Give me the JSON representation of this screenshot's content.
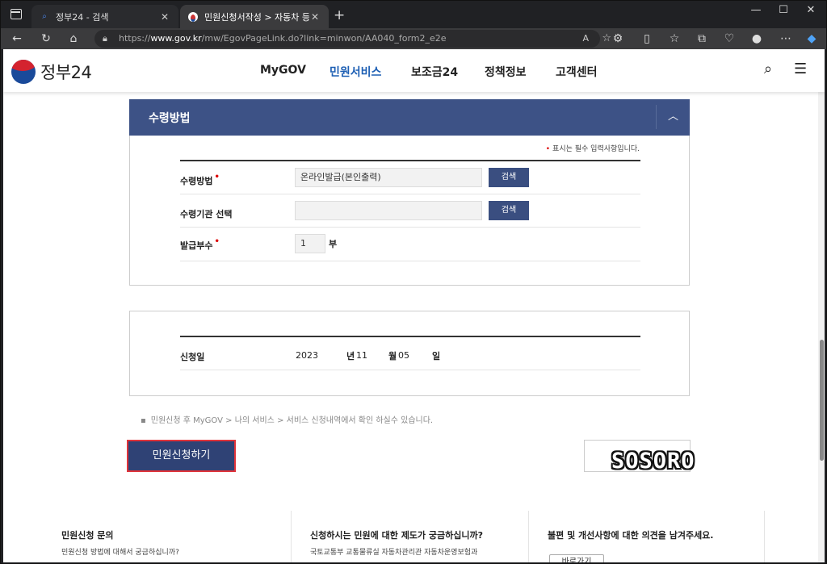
{
  "browser": {
    "tabs": [
      {
        "title": "정부24 - 검색",
        "favicon": "search-icon"
      },
      {
        "title": "민원신청서작성 > 자동차 등록원",
        "favicon": "gov-logo-icon"
      }
    ],
    "url_prefix": "https://",
    "url_host": "www.gov.kr",
    "url_path": "/mw/EgovPageLink.do?link=minwon/AA040_form2_e2e"
  },
  "site": {
    "logo_text": "정부24",
    "nav": [
      "MyGOV",
      "민원서비스",
      "보조금24",
      "정책정보",
      "고객센터"
    ],
    "active_nav": "민원서비스"
  },
  "section": {
    "title": "수령방법",
    "required_note": "표시는 필수 입력사항입니다.",
    "fields": {
      "method_label": "수령방법",
      "method_value": "온라인발급(본인출력)",
      "agency_label": "수령기관 선택",
      "agency_value": "",
      "copies_label": "발급부수",
      "copies_value": "1",
      "copies_unit": "부",
      "search_label": "검색"
    }
  },
  "date_box": {
    "label": "신청일",
    "year": "2023",
    "year_unit": "년",
    "month": "11",
    "month_unit": "월",
    "day": "05",
    "day_unit": "일"
  },
  "notice": "민원신청 후 MyGOV > 나의 서비스 > 서비스 신청내역에서 확인 하실수 있습니다.",
  "apply_button": "민원신청하기",
  "watermark": "SOSORO",
  "footer": {
    "col1_title": "민원신청 문의",
    "col1_sub": "민원신청 방법에 대해서 궁금하십니까?",
    "col2_title": "신청하시는 민원에 대한 제도가 궁금하십니까?",
    "col2_sub": "국토교통부 교통물류실 자동차관리관 자동차운영보험과",
    "col3_title": "불편 및 개선사항에 대한 의견을 남겨주세요.",
    "col3_button": "바로가기"
  }
}
